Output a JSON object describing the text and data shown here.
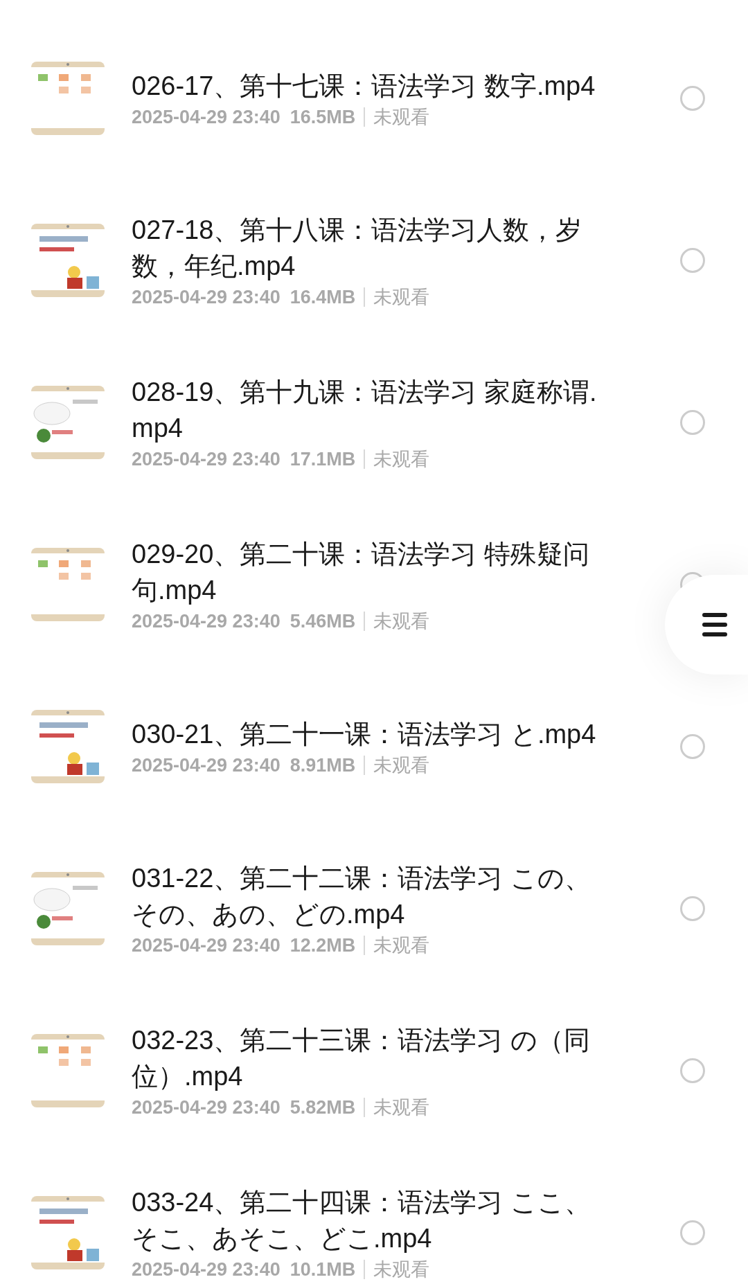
{
  "files": [
    {
      "title": "026-17、第十七课：语法学习 数字.mp4",
      "time": "2025-04-29 23:40",
      "size": "16.5MB",
      "status": "未观看",
      "selected": false
    },
    {
      "title": "027-18、第十八课：语法学习人数，岁数，年纪.mp4",
      "time": "2025-04-29 23:40",
      "size": "16.4MB",
      "status": "未观看",
      "selected": false
    },
    {
      "title": "028-19、第十九课：语法学习 家庭称谓.mp4",
      "time": "2025-04-29 23:40",
      "size": "17.1MB",
      "status": "未观看",
      "selected": false
    },
    {
      "title": "029-20、第二十课：语法学习 特殊疑问句.mp4",
      "time": "2025-04-29 23:40",
      "size": "5.46MB",
      "status": "未观看",
      "selected": false
    },
    {
      "title": "030-21、第二十一课：语法学习 と.mp4",
      "time": "2025-04-29 23:40",
      "size": "8.91MB",
      "status": "未观看",
      "selected": false
    },
    {
      "title": "031-22、第二十二课：语法学习 この、その、あの、どの.mp4",
      "time": "2025-04-29 23:40",
      "size": "12.2MB",
      "status": "未观看",
      "selected": false
    },
    {
      "title": "032-23、第二十三课：语法学习 の（同位）.mp4",
      "time": "2025-04-29 23:40",
      "size": "5.82MB",
      "status": "未观看",
      "selected": false
    },
    {
      "title": "033-24、第二十四课：语法学习 ここ、そこ、あそこ、どこ.mp4",
      "time": "2025-04-29 23:40",
      "size": "10.1MB",
      "status": "未观看",
      "selected": false
    }
  ],
  "menu_button": {
    "kind": "hamburger"
  }
}
